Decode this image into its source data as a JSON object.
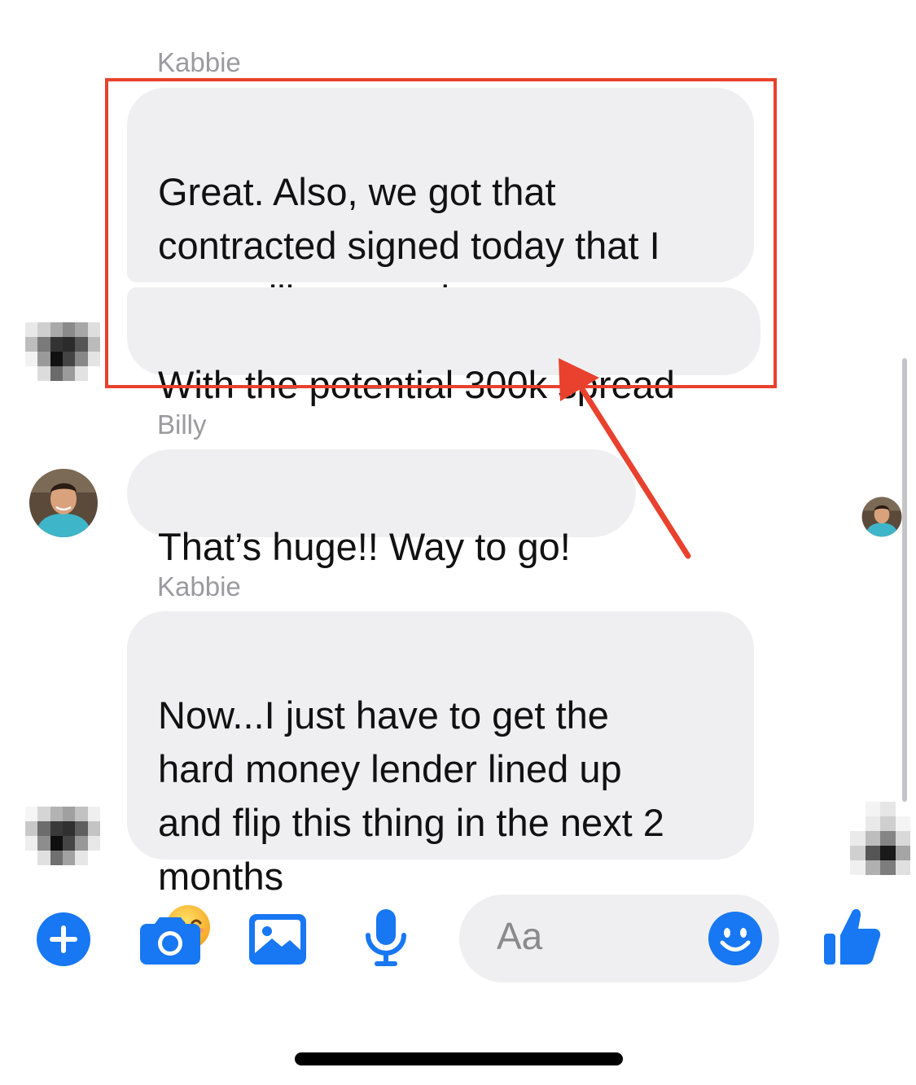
{
  "conversation": {
    "groups": [
      {
        "sender": "Kabbie",
        "messages": [
          "Great. Also, we got that\ncontracted signed today that I\nwas telling you about.",
          "With the potential 300k spread"
        ]
      },
      {
        "sender": "Billy",
        "messages": [
          "That’s huge!! Way to go!"
        ]
      },
      {
        "sender": "Kabbie",
        "messages": [
          "Now...I just have to get the\nhard money lender lined up\nand flip this thing in the next 2\nmonths"
        ]
      }
    ]
  },
  "composer": {
    "placeholder": "Aa",
    "icons": [
      "plus-icon",
      "camera-icon",
      "gallery-icon",
      "microphone-icon",
      "emoji-icon",
      "thumbs-up-icon"
    ]
  },
  "annotation": {
    "box_color": "#e8412e",
    "arrow_color": "#e8412e"
  },
  "colors": {
    "accent": "#1877f2",
    "bubble": "#efeff1",
    "sender_label": "#9a9a9f"
  }
}
